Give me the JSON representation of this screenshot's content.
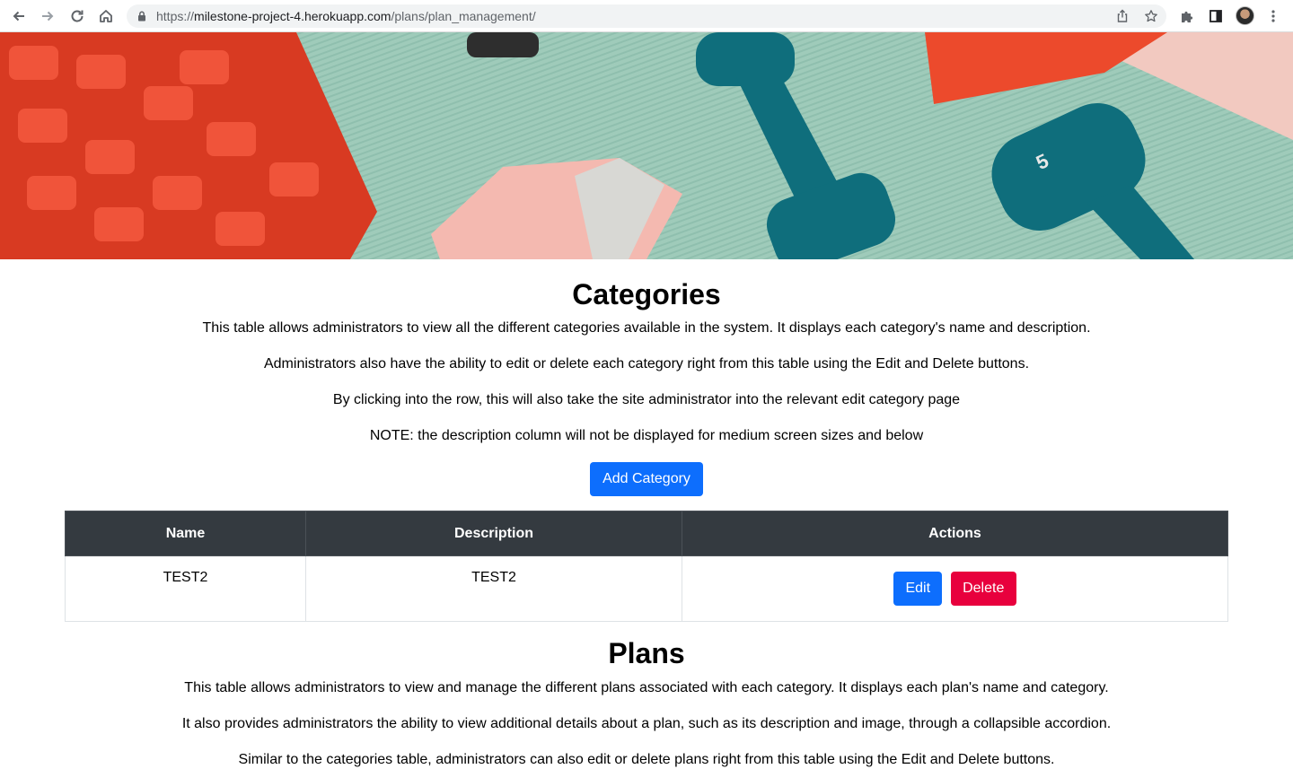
{
  "browser": {
    "url_prefix": "https://",
    "url_host": "milestone-project-4.herokuapp.com",
    "url_path": "/plans/plan_management/"
  },
  "icons": {
    "back": "back-arrow-icon",
    "forward": "forward-arrow-icon",
    "reload": "reload-icon",
    "home": "home-icon",
    "lock": "lock-icon",
    "share": "share-icon",
    "bookmark": "star-icon",
    "extensions": "puzzle-icon",
    "sidepanel": "side-panel-icon",
    "menu": "kebab-menu-icon"
  },
  "colors": {
    "primary": "#0d6efd",
    "danger": "#e8003d",
    "table_header": "#343a40"
  },
  "categories": {
    "title": "Categories",
    "paragraphs": [
      "This table allows administrators to view all the different categories available in the system. It displays each category's name and description.",
      "Administrators also have the ability to edit or delete each category right from this table using the Edit and Delete buttons.",
      "By clicking into the row, this will also take the site administrator into the relevant edit category page",
      "NOTE: the description column will not be displayed for medium screen sizes and below"
    ],
    "add_button": "Add Category",
    "table": {
      "headers": [
        "Name",
        "Description",
        "Actions"
      ],
      "rows": [
        {
          "name": "TEST2",
          "description": "TEST2",
          "edit": "Edit",
          "delete": "Delete"
        }
      ]
    }
  },
  "plans": {
    "title": "Plans",
    "paragraphs": [
      "This table allows administrators to view and manage the different plans associated with each category. It displays each plan's name and category.",
      "It also provides administrators the ability to view additional details about a plan, such as its description and image, through a collapsible accordion.",
      "Similar to the categories table, administrators can also edit or delete plans right from this table using the Edit and Delete buttons."
    ]
  }
}
